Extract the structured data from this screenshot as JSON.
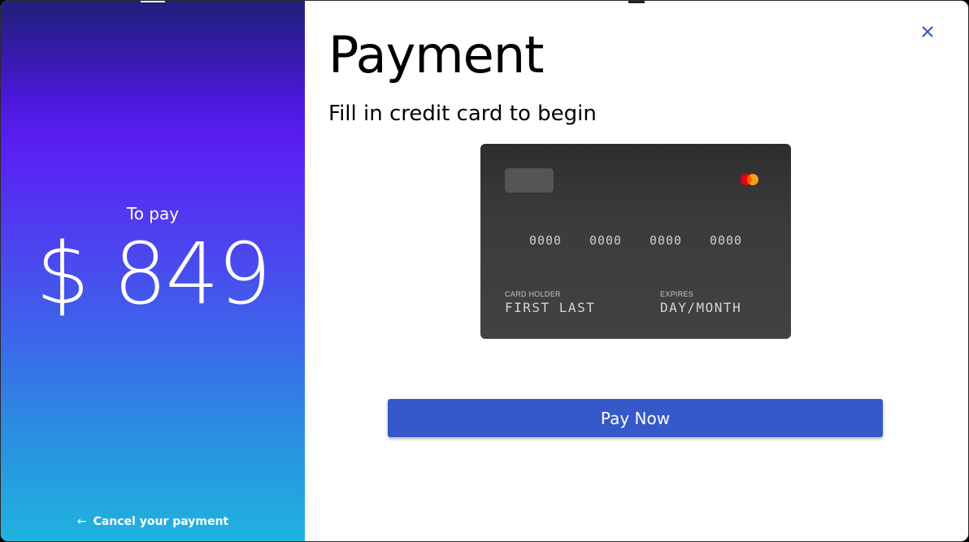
{
  "summary": {
    "to_pay_label": "To pay",
    "amount": "$ 849",
    "cancel_label": "Cancel your payment"
  },
  "form": {
    "title": "Payment",
    "subtitle": "Fill in credit card to begin",
    "pay_button_label": "Pay Now"
  },
  "card": {
    "number_groups": [
      "0000",
      "0000",
      "0000",
      "0000"
    ],
    "holder_label": "CARD HOLDER",
    "holder_value": "FIRST LAST",
    "expires_label": "EXPIRES",
    "expires_value": "DAY/MONTH",
    "brand_icon": "mastercard-icon"
  },
  "icons": {
    "close": "close-icon",
    "back": "arrow-left-icon"
  },
  "colors": {
    "accent": "#3559c9",
    "card_bg": "#3b3b3b",
    "gradient_top": "#1e2078",
    "gradient_mid": "#5b1ef5",
    "gradient_bottom": "#1fb4df"
  }
}
